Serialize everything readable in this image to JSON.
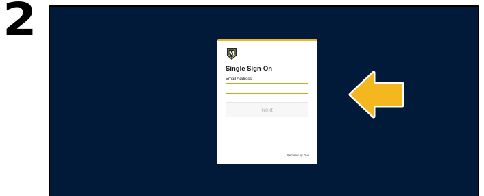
{
  "step": {
    "number": "2"
  },
  "login_card": {
    "logo_letter": "M",
    "logo_icon": "shield-logo",
    "title": "Single Sign-On",
    "email_label": "Email Address",
    "email_value": "",
    "email_placeholder": "",
    "next_label": "Next",
    "footer_text": "Secured by Duo"
  },
  "annotation": {
    "icon": "yellow-arrow-pointing-left"
  },
  "colors": {
    "background": "#021a3a",
    "card_accent": "#e9b826",
    "arrow": "#f4b81e",
    "input_border": "#d9a21b",
    "logo": "#1c2a3a"
  }
}
